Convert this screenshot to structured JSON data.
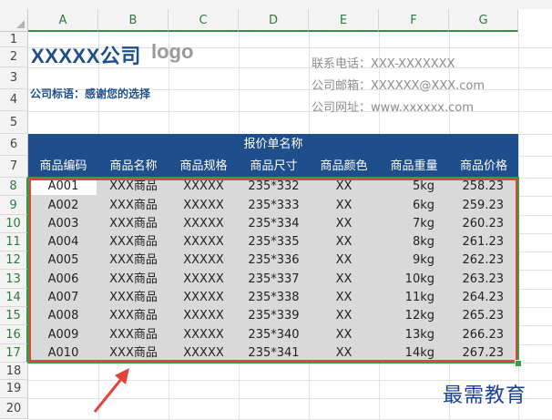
{
  "columns": [
    "A",
    "B",
    "C",
    "D",
    "E",
    "F",
    "G"
  ],
  "rows": [
    "1",
    "2",
    "3",
    "4",
    "5",
    "6",
    "7",
    "8",
    "9",
    "10",
    "11",
    "12",
    "13",
    "14",
    "15",
    "16",
    "17",
    "18",
    "19",
    "20"
  ],
  "company": {
    "title": "XXXXX公司",
    "logo": "logo",
    "slogan": "公司标语：感谢您的选择"
  },
  "contacts": [
    "联系电话：XXX-XXXXXXX",
    "公司邮箱：XXXXXX@XXX.com",
    "公司网址：www.xxxxxx.com"
  ],
  "table": {
    "title": "报价单名称",
    "headers": [
      "商品编码",
      "商品名称",
      "商品规格",
      "商品尺寸",
      "商品颜色",
      "商品重量",
      "商品价格"
    ],
    "rows": [
      [
        "A001",
        "XXX商品",
        "XXXXX",
        "235*332",
        "XX",
        "5kg",
        "258.23"
      ],
      [
        "A002",
        "XXX商品",
        "XXXXX",
        "235*333",
        "XX",
        "6kg",
        "259.23"
      ],
      [
        "A003",
        "XXX商品",
        "XXXXX",
        "235*334",
        "XX",
        "7kg",
        "260.23"
      ],
      [
        "A004",
        "XXX商品",
        "XXXXX",
        "235*335",
        "XX",
        "8kg",
        "261.23"
      ],
      [
        "A005",
        "XXX商品",
        "XXXXX",
        "235*336",
        "XX",
        "9kg",
        "262.23"
      ],
      [
        "A006",
        "XXX商品",
        "XXXXX",
        "235*337",
        "XX",
        "10kg",
        "263.23"
      ],
      [
        "A007",
        "XXX商品",
        "XXXXX",
        "235*338",
        "XX",
        "11kg",
        "264.23"
      ],
      [
        "A008",
        "XXX商品",
        "XXXXX",
        "235*339",
        "XX",
        "12kg",
        "265.23"
      ],
      [
        "A009",
        "XXX商品",
        "XXXXX",
        "235*340",
        "XX",
        "13kg",
        "266.23"
      ],
      [
        "A010",
        "XXX商品",
        "XXXXX",
        "235*341",
        "XX",
        "14kg",
        "267.23"
      ]
    ]
  },
  "watermark": "最需教育",
  "colors": {
    "header_band": "#1f4e8c",
    "selection": "#3a9a45",
    "highlight": "#e0443a",
    "body_fill": "#d9d9d9"
  }
}
